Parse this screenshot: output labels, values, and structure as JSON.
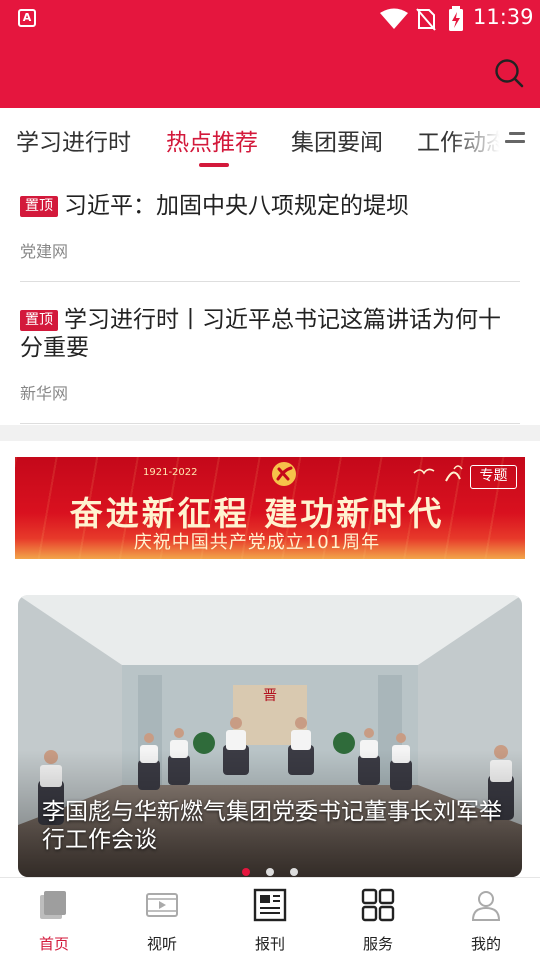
{
  "status_bar": {
    "app_badge": "A",
    "time": "11:39",
    "icons": [
      "wifi-icon",
      "no-sim-icon",
      "battery-charging-icon"
    ]
  },
  "header": {
    "search_icon": "search-icon"
  },
  "tabs": [
    {
      "label": "学习进行时",
      "active": false
    },
    {
      "label": "热点推荐",
      "active": true
    },
    {
      "label": "集团要闻",
      "active": false
    },
    {
      "label": "工作动态",
      "active": false
    }
  ],
  "tabs_menu_icon": "menu-icon",
  "news": [
    {
      "badge": "置顶",
      "title": "习近平：加固中央八项规定的堤坝",
      "source": "党建网"
    },
    {
      "badge": "置顶",
      "title": "学习进行时丨习近平总书记这篇讲话为何十分重要",
      "source": "新华网"
    }
  ],
  "banner": {
    "years": "1921-2022",
    "slogan": "奋进新征程  建功新时代",
    "subtitle": "庆祝中国共产党成立101周年",
    "tag": "专题"
  },
  "photo_card": {
    "caption": "李国彪与华新燃气集团党委书记董事长刘军举行工作会谈",
    "slide_count": 3,
    "active_slide": 0
  },
  "bottom_nav": [
    {
      "label": "首页",
      "icon": "home-icon",
      "active": true
    },
    {
      "label": "视听",
      "icon": "video-icon",
      "active": false
    },
    {
      "label": "报刊",
      "icon": "newspaper-icon",
      "active": false
    },
    {
      "label": "服务",
      "icon": "services-grid-icon",
      "active": false
    },
    {
      "label": "我的",
      "icon": "profile-icon",
      "active": false
    }
  ],
  "colors": {
    "brand": "#e5163e",
    "accent": "#d3193b"
  }
}
